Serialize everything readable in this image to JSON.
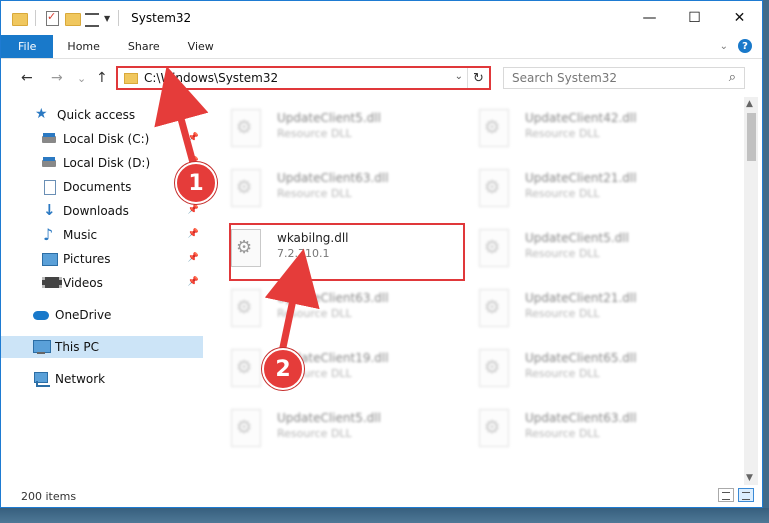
{
  "window": {
    "title": "System32",
    "controls": {
      "minimize": "—",
      "maximize": "☐",
      "close": "✕"
    }
  },
  "ribbon": {
    "tabs": [
      "File",
      "Home",
      "Share",
      "View"
    ],
    "help": "?"
  },
  "nav": {
    "back": "←",
    "forward": "→",
    "recent": "⌄",
    "up": "↑"
  },
  "address": {
    "path": "C:\\Windows\\System32",
    "refresh": "↻"
  },
  "search": {
    "placeholder": "Search System32",
    "icon": "⌕"
  },
  "sidebar": {
    "items": [
      {
        "label": "Quick access",
        "icon": "star-icon",
        "pinned": false
      },
      {
        "label": "Local Disk (C:)",
        "icon": "disk-icon",
        "pinned": true
      },
      {
        "label": "Local Disk (D:)",
        "icon": "disk-icon",
        "pinned": true
      },
      {
        "label": "Documents",
        "icon": "documents-icon",
        "pinned": true
      },
      {
        "label": "Downloads",
        "icon": "downloads-icon",
        "pinned": true
      },
      {
        "label": "Music",
        "icon": "music-icon",
        "pinned": true
      },
      {
        "label": "Pictures",
        "icon": "pictures-icon",
        "pinned": true
      },
      {
        "label": "Videos",
        "icon": "videos-icon",
        "pinned": true
      },
      {
        "label": "OneDrive",
        "icon": "onedrive-icon",
        "pinned": false
      },
      {
        "label": "This PC",
        "icon": "this-pc-icon",
        "pinned": false,
        "selected": true
      },
      {
        "label": "Network",
        "icon": "network-icon",
        "pinned": false
      }
    ]
  },
  "files": {
    "left": [
      {
        "name": "UpdateClient5.dll",
        "type": "Resource DLL",
        "blurred": true
      },
      {
        "name": "UpdateClient63.dll",
        "type": "Resource DLL",
        "blurred": true
      },
      {
        "name": "wkabilng.dll",
        "type": "7.2.710.1",
        "blurred": false,
        "highlighted": true
      },
      {
        "name": "UpdateClient63.dll",
        "type": "Resource DLL",
        "blurred": true
      },
      {
        "name": "UpdateClient19.dll",
        "type": "Resource DLL",
        "blurred": true
      },
      {
        "name": "UpdateClient5.dll",
        "type": "Resource DLL",
        "blurred": true
      }
    ],
    "right": [
      {
        "name": "UpdateClient42.dll",
        "type": "Resource DLL",
        "blurred": true
      },
      {
        "name": "UpdateClient21.dll",
        "type": "Resource DLL",
        "blurred": true
      },
      {
        "name": "UpdateClient5.dll",
        "type": "Resource DLL",
        "blurred": true
      },
      {
        "name": "UpdateClient21.dll",
        "type": "Resource DLL",
        "blurred": true
      },
      {
        "name": "UpdateClient65.dll",
        "type": "Resource DLL",
        "blurred": true
      },
      {
        "name": "UpdateClient63.dll",
        "type": "Resource DLL",
        "blurred": true
      }
    ]
  },
  "status": {
    "item_count": "200 items"
  },
  "annotations": {
    "step1": "1",
    "step2": "2",
    "color": "#e53c3a"
  }
}
